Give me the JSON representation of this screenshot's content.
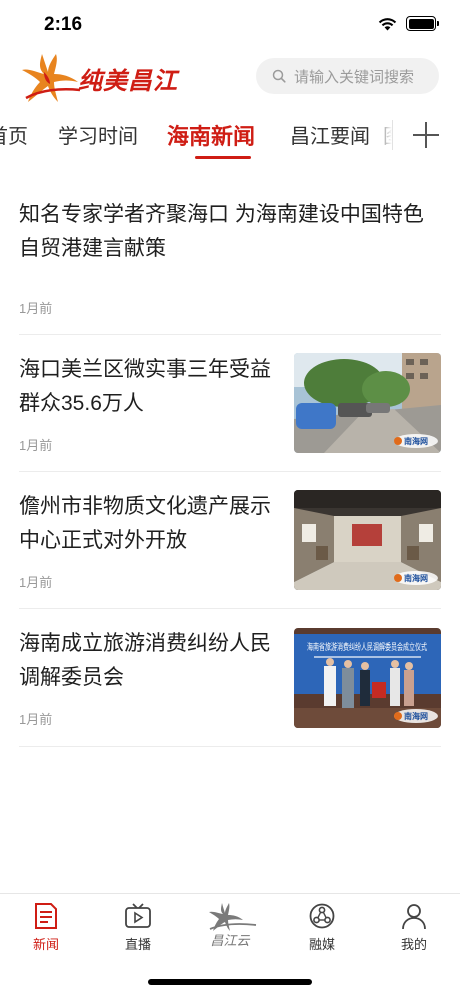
{
  "status_bar": {
    "time": "2:16"
  },
  "header": {
    "logo_text": "纯美昌江",
    "search_placeholder": "请输入关键词搜索"
  },
  "tabs": [
    {
      "label": "首页"
    },
    {
      "label": "学习时间"
    },
    {
      "label": "海南新闻",
      "active": true
    },
    {
      "label": "昌江要闻"
    },
    {
      "label": "图"
    }
  ],
  "news": [
    {
      "title": "知名专家学者齐聚海口 为海南建设中国特色自贸港建言献策",
      "time": "1月前"
    },
    {
      "title": "海口美兰区微实事三年受益群众35.6万人",
      "time": "1月前",
      "thumb_watermark": "南海网"
    },
    {
      "title": "儋州市非物质文化遗产展示中心正式对外开放",
      "time": "1月前",
      "thumb_watermark": "南海网"
    },
    {
      "title": "海南成立旅游消费纠纷人民调解委员会",
      "time": "1月前",
      "thumb_watermark": "南海网",
      "thumb_banner_text": "海南省旅游消费纠纷人民调解委员会成立仪式"
    }
  ],
  "bottom_nav": [
    {
      "label": "新闻",
      "icon": "news-icon",
      "active": true
    },
    {
      "label": "直播",
      "icon": "tv-icon"
    },
    {
      "label": "昌江云",
      "icon": "changjiang-cloud-logo-icon"
    },
    {
      "label": "融媒",
      "icon": "media-hub-icon"
    },
    {
      "label": "我的",
      "icon": "user-icon"
    }
  ],
  "colors": {
    "accent": "#cf1d14",
    "text": "#1f1f1f",
    "muted": "#999999"
  }
}
